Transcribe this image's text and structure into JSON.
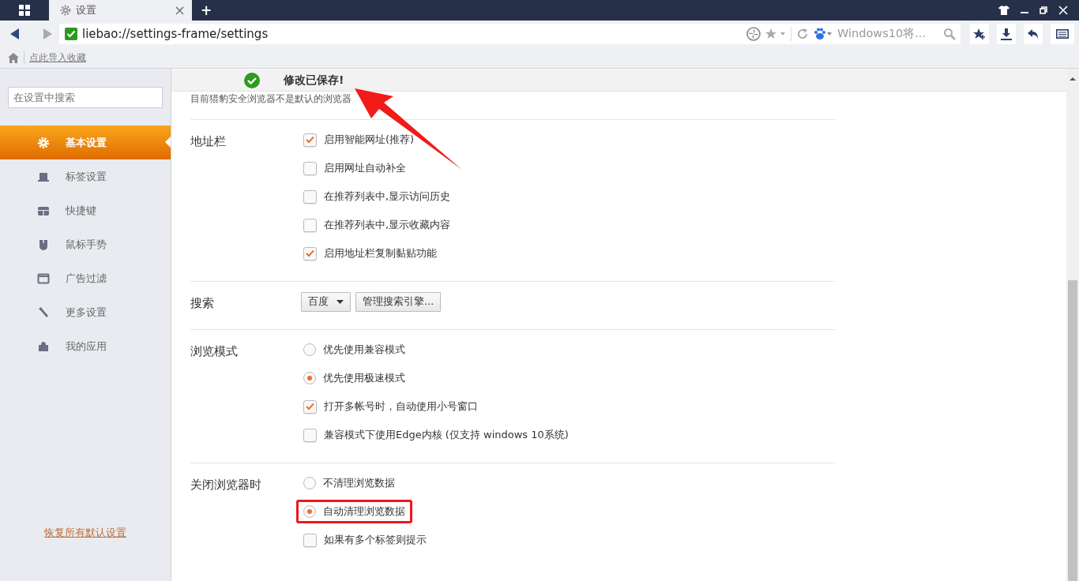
{
  "tab": {
    "title": "设置",
    "close": "×",
    "new_tab": "+"
  },
  "address_bar": {
    "url": "liebao://settings-frame/settings",
    "search_text": "Windows10将..."
  },
  "bookmarks_bar": {
    "link": "点此导入收藏"
  },
  "sidebar": {
    "search": {
      "placeholder": "在设置中搜索"
    },
    "items": [
      {
        "label": "基本设置",
        "selected": true
      },
      {
        "label": "标签设置",
        "selected": false
      },
      {
        "label": "快捷键",
        "selected": false
      },
      {
        "label": "鼠标手势",
        "selected": false
      },
      {
        "label": "广告过滤",
        "selected": false
      },
      {
        "label": "更多设置",
        "selected": false
      },
      {
        "label": "我的应用",
        "selected": false
      }
    ],
    "restore_link": "恢复所有默认设置"
  },
  "saved_banner": {
    "text": "修改已保存!"
  },
  "notice": "目前猎豹安全浏览器不是默认的浏览器",
  "sections": [
    {
      "label": "地址栏",
      "kind": "options",
      "options": [
        {
          "kind": "checkbox",
          "label": "启用智能网址(推荐)",
          "checked": true,
          "highlighted": false
        },
        {
          "kind": "checkbox",
          "label": "启用网址自动补全",
          "checked": false,
          "highlighted": false
        },
        {
          "kind": "checkbox",
          "label": "在推荐列表中,显示访问历史",
          "checked": false,
          "highlighted": false
        },
        {
          "kind": "checkbox",
          "label": "在推荐列表中,显示收藏内容",
          "checked": false,
          "highlighted": false
        },
        {
          "kind": "checkbox",
          "label": "启用地址栏复制黏贴功能",
          "checked": true,
          "highlighted": false
        }
      ]
    },
    {
      "label": "搜索",
      "kind": "controls",
      "select": "百度",
      "button": "管理搜索引擎..."
    },
    {
      "label": "浏览模式",
      "kind": "options",
      "options": [
        {
          "kind": "radio",
          "label": "优先使用兼容模式",
          "checked": false,
          "highlighted": false
        },
        {
          "kind": "radio",
          "label": "优先使用极速模式",
          "checked": true,
          "highlighted": false
        },
        {
          "kind": "checkbox",
          "label": "打开多帐号时，自动使用小号窗口",
          "checked": true,
          "highlighted": false
        },
        {
          "kind": "checkbox",
          "label": "兼容模式下使用Edge内核 (仅支持 windows 10系统)",
          "checked": false,
          "highlighted": false
        }
      ]
    },
    {
      "label": "关闭浏览器时",
      "kind": "options",
      "options": [
        {
          "kind": "radio",
          "label": "不清理浏览数据",
          "checked": false,
          "highlighted": false
        },
        {
          "kind": "radio",
          "label": "自动清理浏览数据",
          "checked": true,
          "highlighted": true
        },
        {
          "kind": "checkbox",
          "label": "如果有多个标签则提示",
          "checked": false,
          "highlighted": false
        }
      ]
    }
  ]
}
